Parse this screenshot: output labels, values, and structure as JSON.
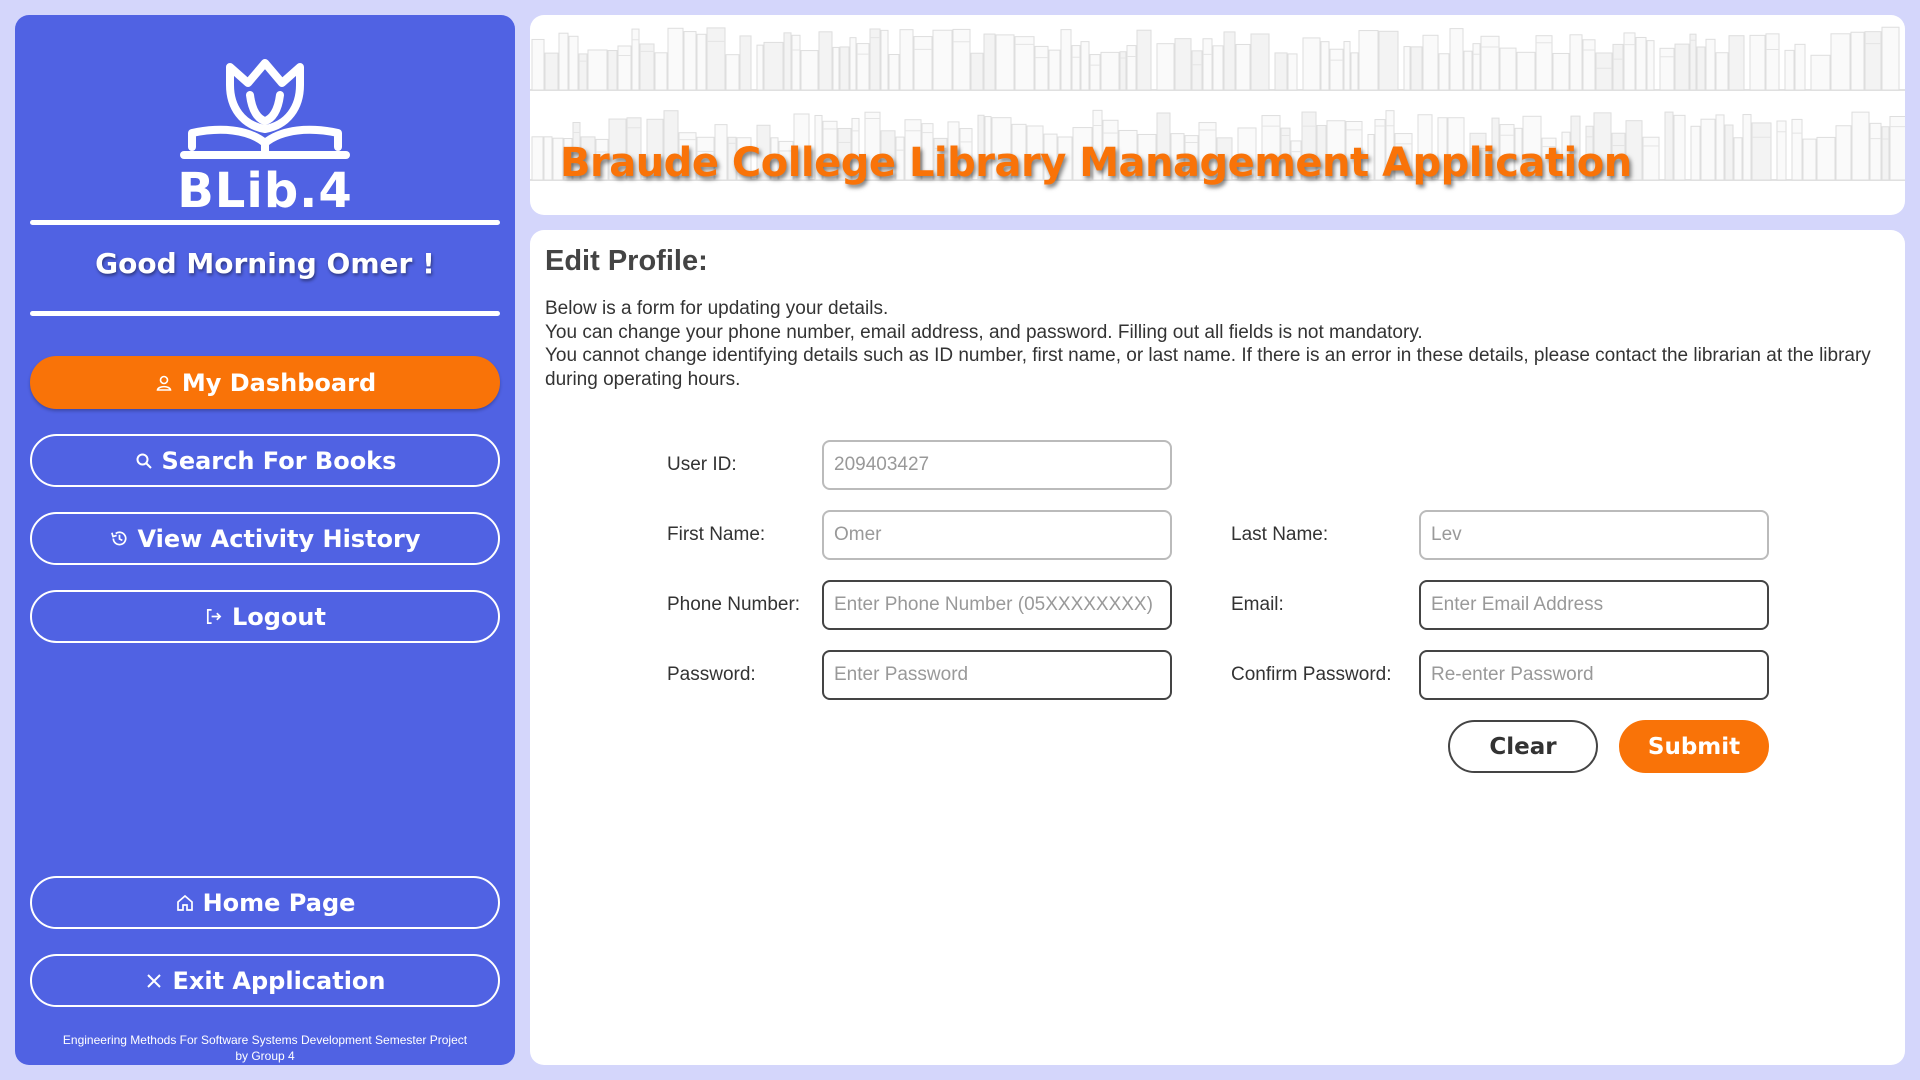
{
  "sidebar": {
    "logo_text": "BLib.4",
    "greeting": "Good Morning Omer !",
    "nav": [
      {
        "label": "My Dashboard",
        "icon": "user-icon",
        "active": true
      },
      {
        "label": "Search For Books",
        "icon": "search-icon"
      },
      {
        "label": "View Activity History",
        "icon": "history-icon"
      },
      {
        "label": "Logout",
        "icon": "logout-icon"
      }
    ],
    "bottom_nav": [
      {
        "label": "Home Page",
        "icon": "home-icon"
      },
      {
        "label": "Exit Application",
        "icon": "close-icon"
      }
    ],
    "footer_line1": "Engineering Methods For Software Systems Development Semester Project",
    "footer_line2": "by Group 4"
  },
  "header": {
    "title": "Braude College Library Management Application"
  },
  "main": {
    "title": "Edit Profile:",
    "description": [
      "Below is a form for updating your details.",
      "You can change your phone number, email address, and password. Filling out all fields is not mandatory.",
      "You cannot change identifying details such as ID number, first name, or last name. If there is an error in these details, please contact the librarian at the library during operating hours."
    ],
    "form": {
      "user_id_label": "User ID:",
      "user_id_value": "209403427",
      "first_name_label": "First Name:",
      "first_name_value": "Omer",
      "last_name_label": "Last Name:",
      "last_name_value": "Lev",
      "phone_label": "Phone Number:",
      "phone_placeholder": "Enter Phone Number (05XXXXXXXX)",
      "email_label": "Email:",
      "email_placeholder": "Enter Email Address",
      "password_label": "Password:",
      "password_placeholder": "Enter Password",
      "confirm_label": "Confirm Password:",
      "confirm_placeholder": "Re-enter Password"
    },
    "clear_label": "Clear",
    "submit_label": "Submit"
  },
  "colors": {
    "accent": "#f97308",
    "sidebar_bg": "#5062e3",
    "page_bg": "#d4d6fb"
  }
}
